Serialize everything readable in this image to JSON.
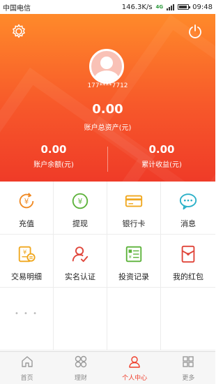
{
  "status_bar": {
    "carrier": "中国电信",
    "speed": "146.3K/s",
    "network": "4G",
    "time": "09:48"
  },
  "account": {
    "phone": "177****7712",
    "total_assets_value": "0.00",
    "total_assets_label": "账户总资产(元)",
    "balance_value": "0.00",
    "balance_label": "账户余额(元)",
    "earnings_value": "0.00",
    "earnings_label": "累计收益(元)"
  },
  "grid": {
    "items": [
      {
        "label": "充值",
        "icon": "recharge-icon",
        "color": "#f08a24"
      },
      {
        "label": "提现",
        "icon": "withdraw-icon",
        "color": "#5cb23a"
      },
      {
        "label": "银行卡",
        "icon": "bank-card-icon",
        "color": "#f0a820"
      },
      {
        "label": "消息",
        "icon": "message-icon",
        "color": "#2ab0c8"
      },
      {
        "label": "交易明细",
        "icon": "transaction-details-icon",
        "color": "#f0a820"
      },
      {
        "label": "实名认证",
        "icon": "verify-identity-icon",
        "color": "#e0453a"
      },
      {
        "label": "投资记录",
        "icon": "investment-record-icon",
        "color": "#5cb23a"
      },
      {
        "label": "我的红包",
        "icon": "red-envelope-icon",
        "color": "#e0453a"
      }
    ],
    "more_text": "• • •"
  },
  "tabbar": {
    "tabs": [
      {
        "label": "首页",
        "icon": "home-icon",
        "active": false
      },
      {
        "label": "理财",
        "icon": "finance-icon",
        "active": false
      },
      {
        "label": "个人中心",
        "icon": "user-center-icon",
        "active": true
      },
      {
        "label": "更多",
        "icon": "more-icon",
        "active": false
      }
    ]
  },
  "colors": {
    "accent": "#ef3b28",
    "header_top": "#ff8a2a",
    "header_bottom": "#ef3b28"
  }
}
